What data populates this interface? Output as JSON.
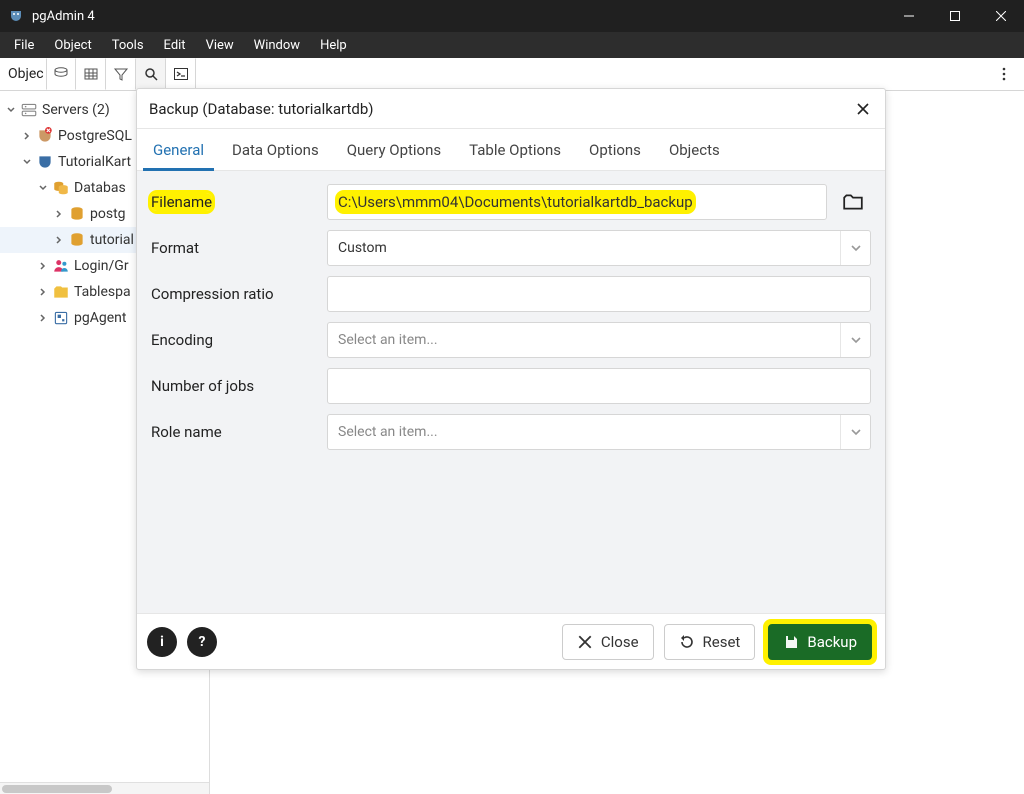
{
  "titlebar": {
    "title": "pgAdmin 4"
  },
  "menubar": [
    "File",
    "Object",
    "Tools",
    "Edit",
    "View",
    "Window",
    "Help"
  ],
  "toolbar": {
    "label_left": "Objec"
  },
  "tree": {
    "servers_label": "Servers (2)",
    "postgresql_label": "PostgreSQL",
    "tutorialkart_label": "TutorialKart",
    "databases_label": "Databas",
    "postgres_label": "postg",
    "tutorialdb_label": "tutorial",
    "login_label": "Login/Gr",
    "tablespaces_label": "Tablespa",
    "pgagent_label": "pgAgent"
  },
  "dialog": {
    "title": "Backup (Database: tutorialkartdb)",
    "tabs": [
      "General",
      "Data Options",
      "Query Options",
      "Table Options",
      "Options",
      "Objects"
    ],
    "labels": {
      "filename": "Filename",
      "format": "Format",
      "compression": "Compression ratio",
      "encoding": "Encoding",
      "numjobs": "Number of jobs",
      "rolename": "Role name"
    },
    "values": {
      "filename": "C:\\Users\\mmm04\\Documents\\tutorialkartdb_backup",
      "format": "Custom"
    },
    "placeholders": {
      "encoding": "Select an item...",
      "rolename": "Select an item..."
    },
    "footer": {
      "close": "Close",
      "reset": "Reset",
      "backup": "Backup"
    }
  }
}
